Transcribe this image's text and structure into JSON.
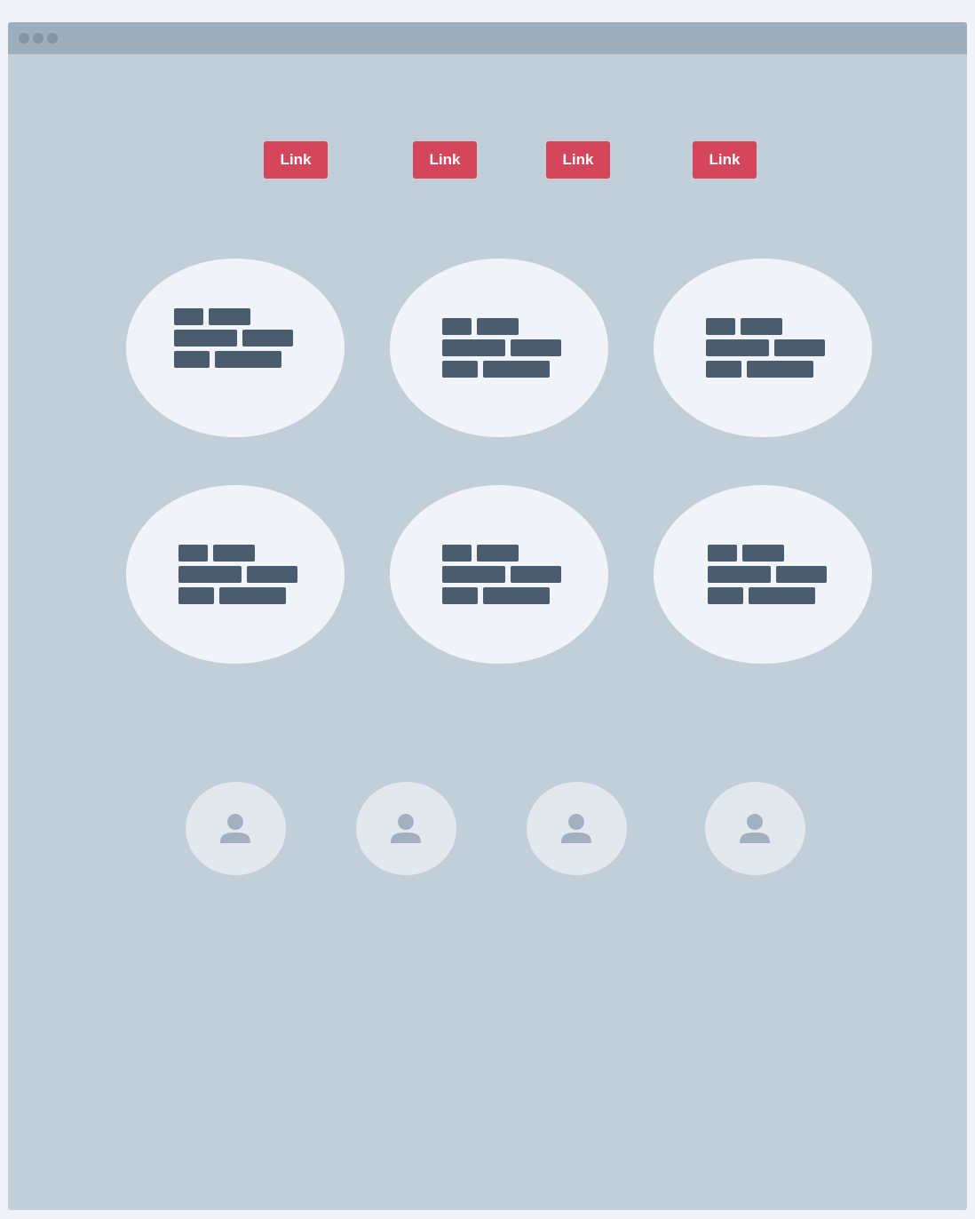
{
  "window": {
    "controls": [
      "close",
      "minimize",
      "maximize"
    ]
  },
  "nav": {
    "links": [
      {
        "label": "Link"
      },
      {
        "label": "Link"
      },
      {
        "label": "Link"
      },
      {
        "label": "Link"
      }
    ]
  },
  "tiles": {
    "count": 6,
    "icon": "brick-placeholder-icon"
  },
  "avatars": {
    "count": 4,
    "icon": "user-icon"
  },
  "colors": {
    "page_background": "#f0f4f8",
    "window_background": "#c2cfd9",
    "titlebar": "#9dafbd",
    "button": "#d4465b",
    "button_text": "#ffffff",
    "tile": "#f0f4f8",
    "brick": "#4a5c6d",
    "avatar": "#e2e8ed",
    "avatar_icon": "#a3b1bf"
  }
}
